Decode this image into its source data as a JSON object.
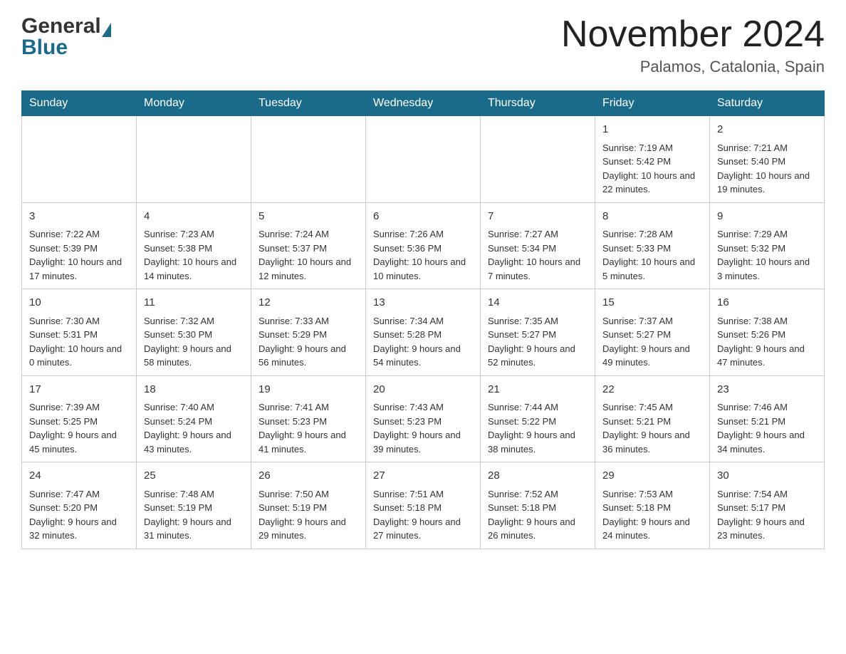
{
  "header": {
    "logo_general": "General",
    "logo_blue": "Blue",
    "month_title": "November 2024",
    "location": "Palamos, Catalonia, Spain"
  },
  "days_of_week": [
    "Sunday",
    "Monday",
    "Tuesday",
    "Wednesday",
    "Thursday",
    "Friday",
    "Saturday"
  ],
  "weeks": [
    [
      {
        "day": "",
        "info": ""
      },
      {
        "day": "",
        "info": ""
      },
      {
        "day": "",
        "info": ""
      },
      {
        "day": "",
        "info": ""
      },
      {
        "day": "",
        "info": ""
      },
      {
        "day": "1",
        "info": "Sunrise: 7:19 AM\nSunset: 5:42 PM\nDaylight: 10 hours and 22 minutes."
      },
      {
        "day": "2",
        "info": "Sunrise: 7:21 AM\nSunset: 5:40 PM\nDaylight: 10 hours and 19 minutes."
      }
    ],
    [
      {
        "day": "3",
        "info": "Sunrise: 7:22 AM\nSunset: 5:39 PM\nDaylight: 10 hours and 17 minutes."
      },
      {
        "day": "4",
        "info": "Sunrise: 7:23 AM\nSunset: 5:38 PM\nDaylight: 10 hours and 14 minutes."
      },
      {
        "day": "5",
        "info": "Sunrise: 7:24 AM\nSunset: 5:37 PM\nDaylight: 10 hours and 12 minutes."
      },
      {
        "day": "6",
        "info": "Sunrise: 7:26 AM\nSunset: 5:36 PM\nDaylight: 10 hours and 10 minutes."
      },
      {
        "day": "7",
        "info": "Sunrise: 7:27 AM\nSunset: 5:34 PM\nDaylight: 10 hours and 7 minutes."
      },
      {
        "day": "8",
        "info": "Sunrise: 7:28 AM\nSunset: 5:33 PM\nDaylight: 10 hours and 5 minutes."
      },
      {
        "day": "9",
        "info": "Sunrise: 7:29 AM\nSunset: 5:32 PM\nDaylight: 10 hours and 3 minutes."
      }
    ],
    [
      {
        "day": "10",
        "info": "Sunrise: 7:30 AM\nSunset: 5:31 PM\nDaylight: 10 hours and 0 minutes."
      },
      {
        "day": "11",
        "info": "Sunrise: 7:32 AM\nSunset: 5:30 PM\nDaylight: 9 hours and 58 minutes."
      },
      {
        "day": "12",
        "info": "Sunrise: 7:33 AM\nSunset: 5:29 PM\nDaylight: 9 hours and 56 minutes."
      },
      {
        "day": "13",
        "info": "Sunrise: 7:34 AM\nSunset: 5:28 PM\nDaylight: 9 hours and 54 minutes."
      },
      {
        "day": "14",
        "info": "Sunrise: 7:35 AM\nSunset: 5:27 PM\nDaylight: 9 hours and 52 minutes."
      },
      {
        "day": "15",
        "info": "Sunrise: 7:37 AM\nSunset: 5:27 PM\nDaylight: 9 hours and 49 minutes."
      },
      {
        "day": "16",
        "info": "Sunrise: 7:38 AM\nSunset: 5:26 PM\nDaylight: 9 hours and 47 minutes."
      }
    ],
    [
      {
        "day": "17",
        "info": "Sunrise: 7:39 AM\nSunset: 5:25 PM\nDaylight: 9 hours and 45 minutes."
      },
      {
        "day": "18",
        "info": "Sunrise: 7:40 AM\nSunset: 5:24 PM\nDaylight: 9 hours and 43 minutes."
      },
      {
        "day": "19",
        "info": "Sunrise: 7:41 AM\nSunset: 5:23 PM\nDaylight: 9 hours and 41 minutes."
      },
      {
        "day": "20",
        "info": "Sunrise: 7:43 AM\nSunset: 5:23 PM\nDaylight: 9 hours and 39 minutes."
      },
      {
        "day": "21",
        "info": "Sunrise: 7:44 AM\nSunset: 5:22 PM\nDaylight: 9 hours and 38 minutes."
      },
      {
        "day": "22",
        "info": "Sunrise: 7:45 AM\nSunset: 5:21 PM\nDaylight: 9 hours and 36 minutes."
      },
      {
        "day": "23",
        "info": "Sunrise: 7:46 AM\nSunset: 5:21 PM\nDaylight: 9 hours and 34 minutes."
      }
    ],
    [
      {
        "day": "24",
        "info": "Sunrise: 7:47 AM\nSunset: 5:20 PM\nDaylight: 9 hours and 32 minutes."
      },
      {
        "day": "25",
        "info": "Sunrise: 7:48 AM\nSunset: 5:19 PM\nDaylight: 9 hours and 31 minutes."
      },
      {
        "day": "26",
        "info": "Sunrise: 7:50 AM\nSunset: 5:19 PM\nDaylight: 9 hours and 29 minutes."
      },
      {
        "day": "27",
        "info": "Sunrise: 7:51 AM\nSunset: 5:18 PM\nDaylight: 9 hours and 27 minutes."
      },
      {
        "day": "28",
        "info": "Sunrise: 7:52 AM\nSunset: 5:18 PM\nDaylight: 9 hours and 26 minutes."
      },
      {
        "day": "29",
        "info": "Sunrise: 7:53 AM\nSunset: 5:18 PM\nDaylight: 9 hours and 24 minutes."
      },
      {
        "day": "30",
        "info": "Sunrise: 7:54 AM\nSunset: 5:17 PM\nDaylight: 9 hours and 23 minutes."
      }
    ]
  ]
}
